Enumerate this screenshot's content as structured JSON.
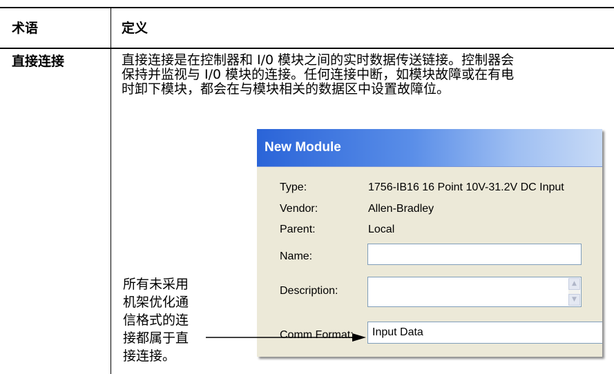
{
  "table": {
    "header": {
      "term": "术语",
      "definition": "定义"
    },
    "rows": [
      {
        "term": "直接连接",
        "definition_lines": [
          "直接连接是在控制器和 I/0 模块之间的实时数据传送链接。控制器会",
          "保持并监视与 I/0 模块的连接。任何连接中断，如模块故障或在有电",
          "时卸下模块，都会在与模块相关的数据区中设置故障位。"
        ]
      }
    ]
  },
  "callout": {
    "lines": [
      "所有未采用",
      "机架优化通",
      "信格式的连",
      "接都属于直",
      "接连接。"
    ]
  },
  "dialog": {
    "title": "New Module",
    "fields": {
      "type_label": "Type:",
      "type_value": "1756-IB16 16 Point 10V-31.2V DC Input",
      "vendor_label": "Vendor:",
      "vendor_value": "Allen-Bradley",
      "parent_label": "Parent:",
      "parent_value": "Local",
      "name_label": "Name:",
      "name_value": "",
      "description_label": "Description:",
      "description_value": "",
      "comm_format_label": "Comm Format:",
      "comm_format_value": "Input Data"
    }
  },
  "colors": {
    "titlebar_start": "#2a64d8",
    "titlebar_end": "#c7daf6",
    "dialog_face": "#ece9d8",
    "input_border": "#7f9db9"
  }
}
